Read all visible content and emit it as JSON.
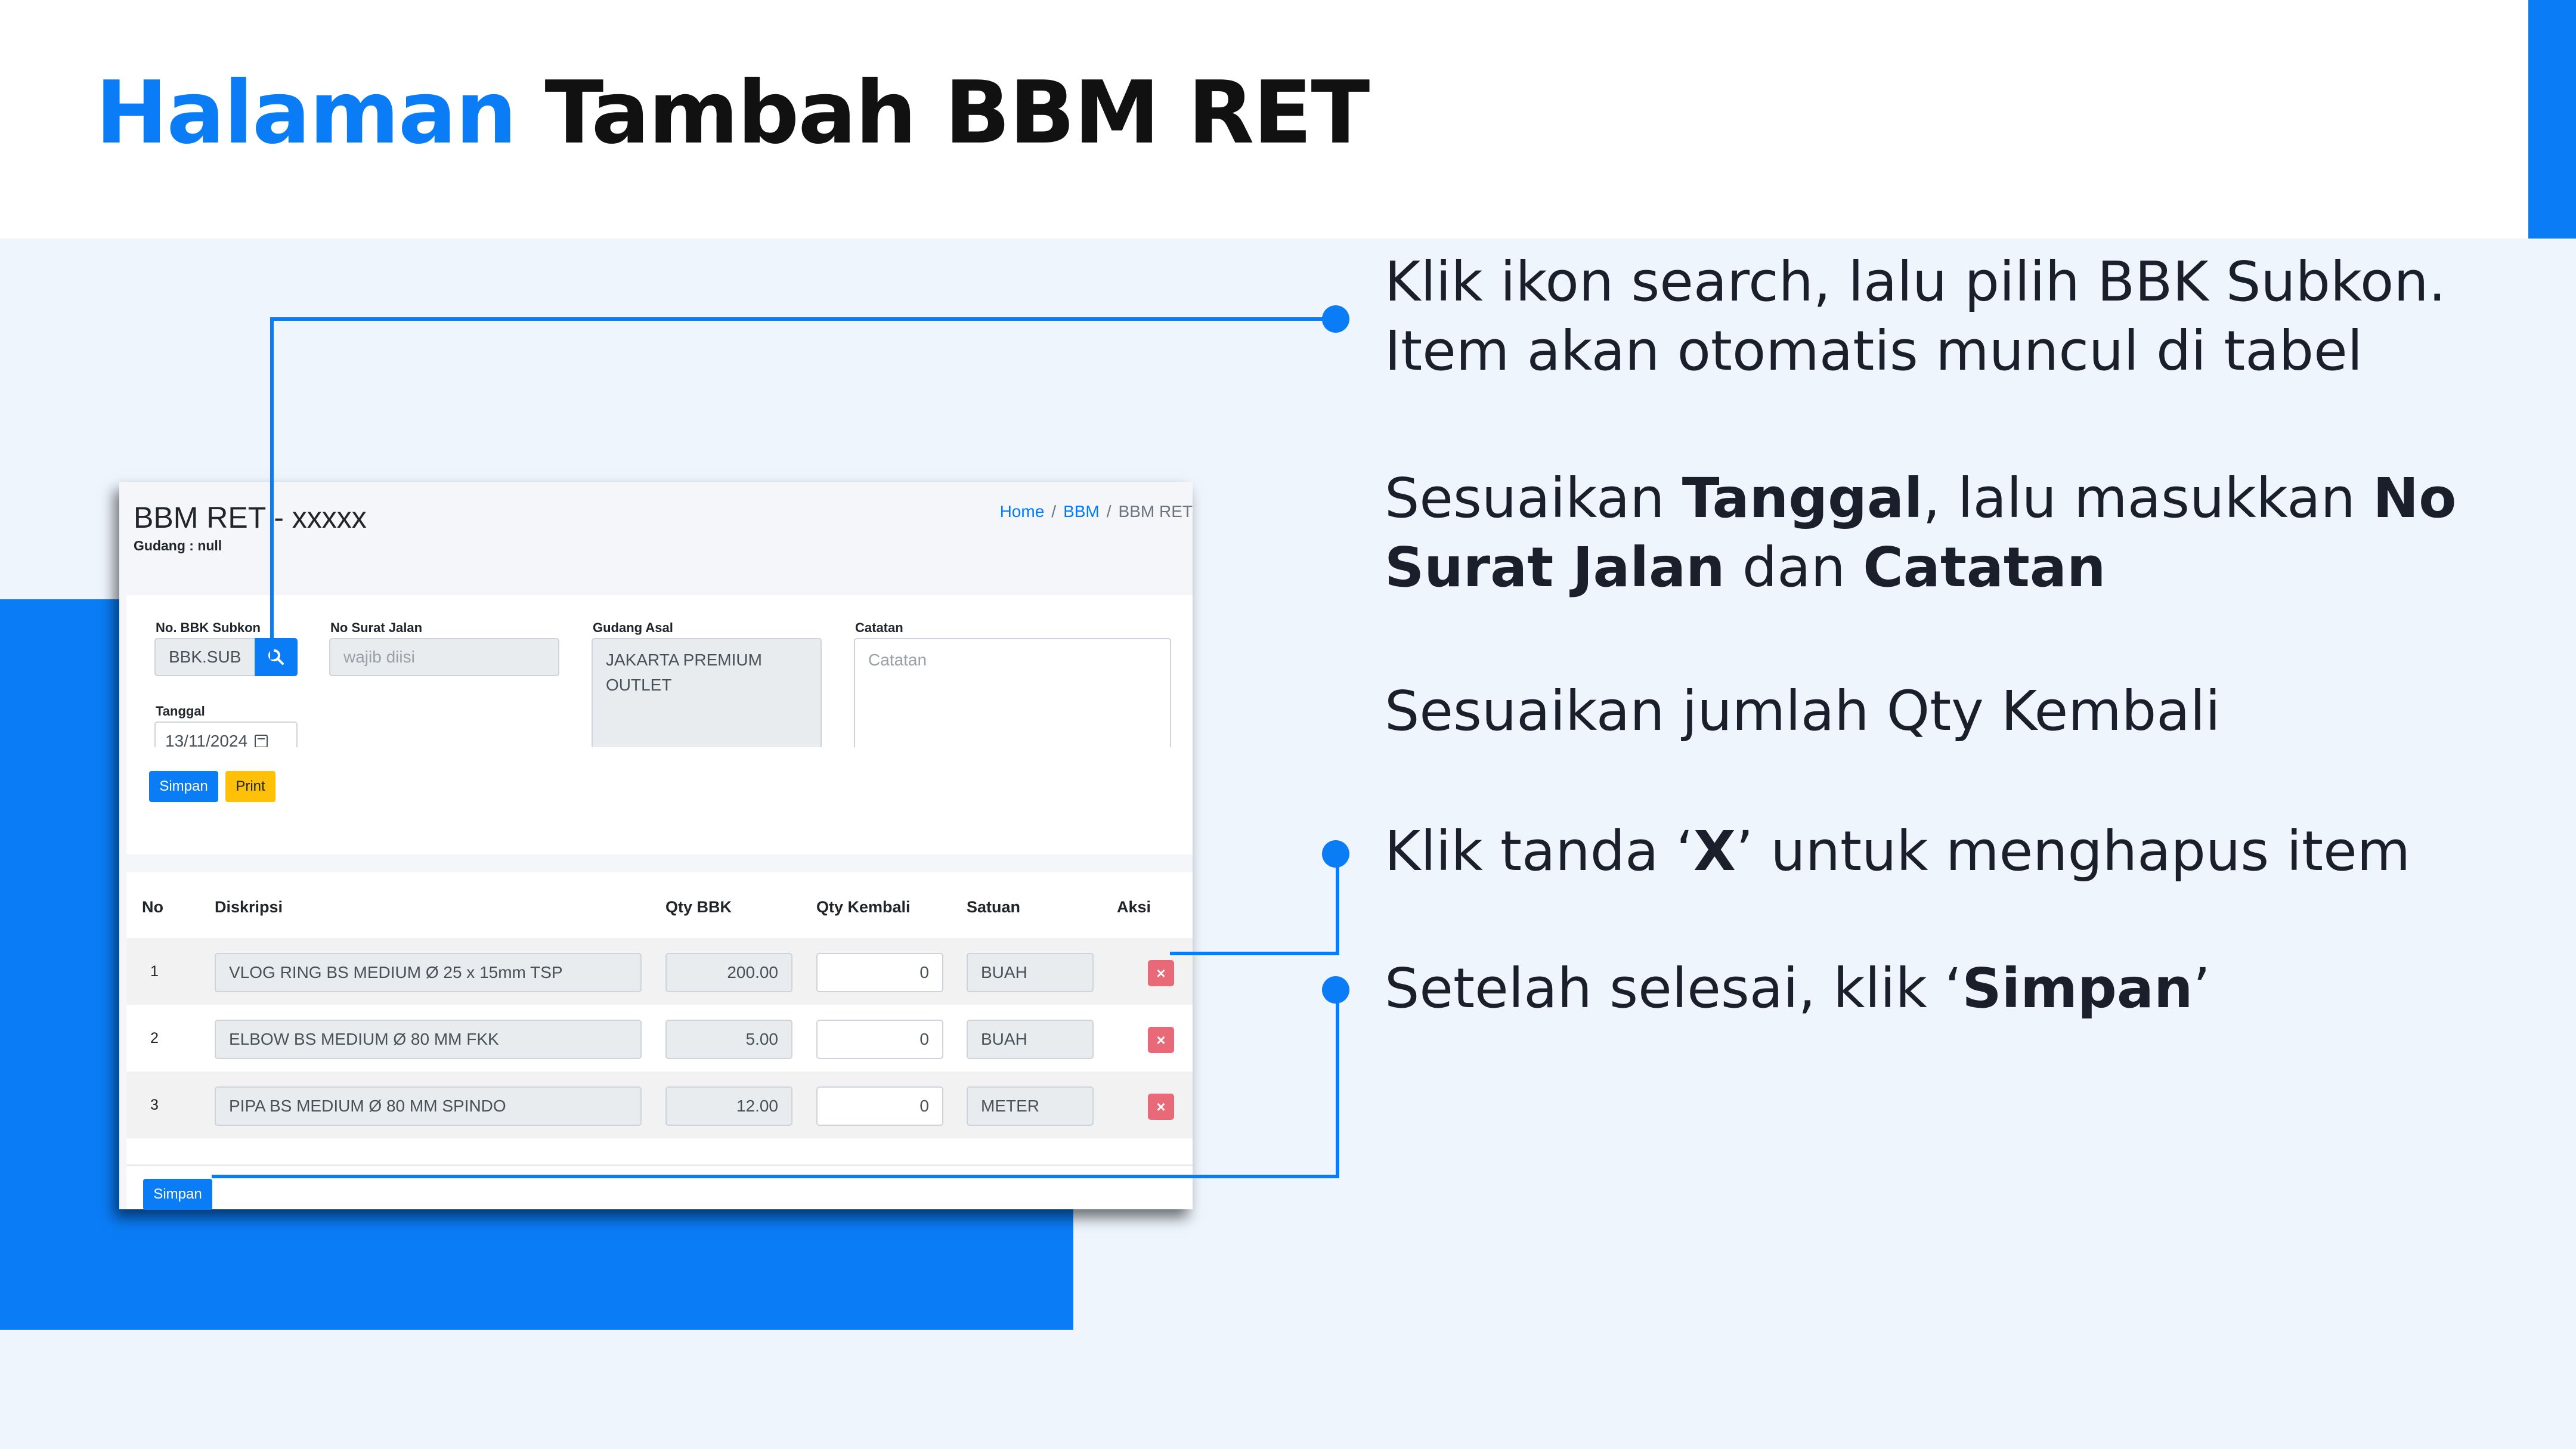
{
  "slide": {
    "title_highlight": "Halaman",
    "title_rest": "Tambah BBM RET",
    "accent_color": "#0a7cf5"
  },
  "app": {
    "page_title": "BBM RET - xxxxx",
    "page_subtitle": "Gudang : null",
    "breadcrumb": [
      "Home",
      "BBM",
      "BBM RET"
    ],
    "form": {
      "no_bbk_label": "No. BBK Subkon",
      "no_bbk_value": "BBK.SUB",
      "no_surat_label": "No Surat Jalan",
      "no_surat_placeholder": "wajib diisi",
      "gudang_label": "Gudang Asal",
      "gudang_value": "JAKARTA PREMIUM OUTLET",
      "catatan_label": "Catatan",
      "catatan_placeholder": "Catatan",
      "tanggal_label": "Tanggal",
      "tanggal_value": "13/11/2024",
      "simpan_label": "Simpan",
      "print_label": "Print"
    },
    "table": {
      "headers": [
        "No",
        "Diskripsi",
        "Qty BBK",
        "Qty Kembali",
        "Satuan",
        "Aksi"
      ],
      "rows": [
        {
          "no": "1",
          "desc": "VLOG RING BS MEDIUM Ø 25 x 15mm TSP",
          "qty_bbk": "200.00",
          "qty_kembali": "0",
          "satuan": "BUAH"
        },
        {
          "no": "2",
          "desc": "ELBOW BS MEDIUM Ø 80 MM FKK",
          "qty_bbk": "5.00",
          "qty_kembali": "0",
          "satuan": "BUAH"
        },
        {
          "no": "3",
          "desc": "PIPA BS MEDIUM Ø 80 MM SPINDO",
          "qty_bbk": "12.00",
          "qty_kembali": "0",
          "satuan": "METER"
        }
      ],
      "delete_glyph": "×",
      "footer_simpan_label": "Simpan"
    }
  },
  "instructions": {
    "s1_line1": "Klik ikon search, lalu pilih BBK Subkon.",
    "s1_line2": "Item akan otomatis muncul di tabel",
    "s2_a": "Sesuaikan ",
    "s2_b": "Tanggal",
    "s2_c": ", lalu masukkan ",
    "s2_d": "No",
    "s2_e": "Surat Jalan",
    "s2_f": " dan ",
    "s2_g": "Catatan",
    "s3": "Sesuaikan jumlah Qty Kembali",
    "s4_a": "Klik tanda ‘",
    "s4_b": "X",
    "s4_c": "’ untuk menghapus item",
    "s5_a": "Setelah selesai, klik ‘",
    "s5_b": "Simpan",
    "s5_c": "’"
  }
}
